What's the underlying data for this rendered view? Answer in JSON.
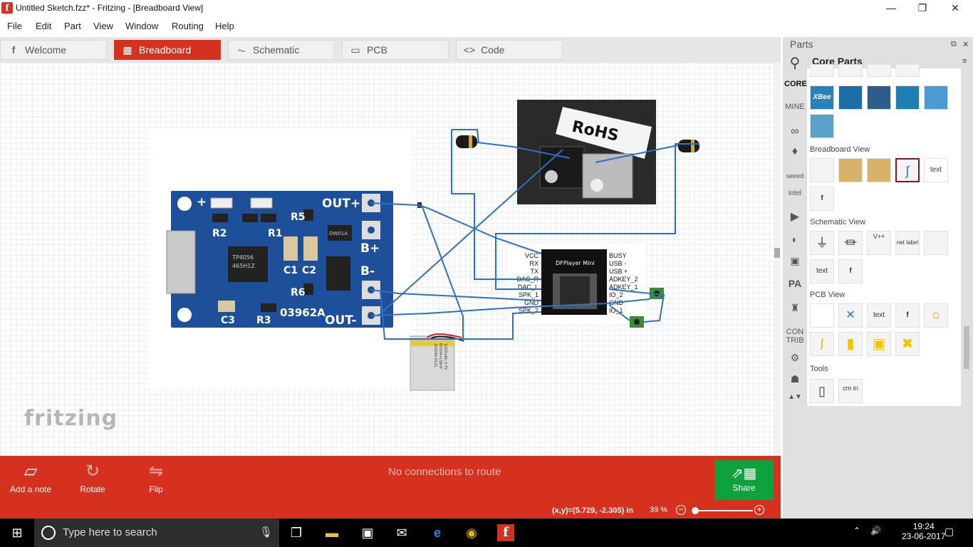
{
  "window": {
    "title": "Untitled Sketch.fzz* - Fritzing - [Breadboard View]",
    "app_icon": "f",
    "minimize": "—",
    "maximize": "❐",
    "close": "✕"
  },
  "menu": [
    "File",
    "Edit",
    "Part",
    "View",
    "Window",
    "Routing",
    "Help"
  ],
  "tabs": [
    {
      "label": "Welcome",
      "icon": "f",
      "active": false
    },
    {
      "label": "Breadboard",
      "icon": "▦",
      "active": true
    },
    {
      "label": "Schematic",
      "icon": "⏦",
      "active": false
    },
    {
      "label": "PCB",
      "icon": "▭",
      "active": false
    },
    {
      "label": "Code",
      "icon": "<>",
      "active": false
    }
  ],
  "canvas": {
    "logo": "fritzing",
    "charger_module": {
      "labels": [
        "+",
        "OUT+",
        "B+",
        "B-",
        "OUT-",
        "R2",
        "R1",
        "R5",
        "R6",
        "C1",
        "C2",
        "C3",
        "R3",
        "TP4056",
        "465H1Z",
        "03962A",
        "DW01A",
        "−"
      ]
    },
    "rohs": "RoHS",
    "dfplayer": {
      "title": "DFPlayer Mini",
      "left_pins": [
        "VCC",
        "RX",
        "TX",
        "DAC_R",
        "DAC_L",
        "SPK_1",
        "GND",
        "SPK_2"
      ],
      "right_pins": [
        "BUSY",
        "USB -",
        "USB +",
        "ADKEY_2",
        "ADKEY_1",
        "IO_2",
        "GND",
        "IO_1"
      ]
    },
    "battery": {
      "lines": [
        "103040-0121",
        "EH104+LSB-H",
        "1200mAh 3.7V"
      ]
    }
  },
  "bottom": {
    "add_note": "Add a note",
    "rotate": "Rotate",
    "flip": "Flip",
    "message": "No connections to route",
    "share": "Share"
  },
  "status": {
    "coords": "(x,y)=(5.729, -2.305) in",
    "zoom": "39 %",
    "zoom_out": "−",
    "zoom_in": "+",
    "zoom_level_fraction": 0.0
  },
  "parts": {
    "title": "Parts",
    "bin_title": "Core Parts",
    "bins": [
      "CORE",
      "MINE",
      "seeed",
      "CON TRIB"
    ],
    "sections": [
      "Breadboard View",
      "Schematic View",
      "PCB View",
      "Tools"
    ],
    "core_items": [
      "XBee"
    ],
    "breadboard_items": [
      "text"
    ],
    "schematic_items": [
      "V++",
      "net label",
      "text"
    ],
    "pcb_items": [
      "text"
    ],
    "tools_items": [
      "cm in"
    ]
  },
  "taskbar": {
    "search_placeholder": "Type here to search",
    "time": "19:24",
    "date": "23-06-2017"
  },
  "colors": {
    "accent": "#d6301f",
    "share": "#0fa13e",
    "wire": "#2f6fc4"
  }
}
